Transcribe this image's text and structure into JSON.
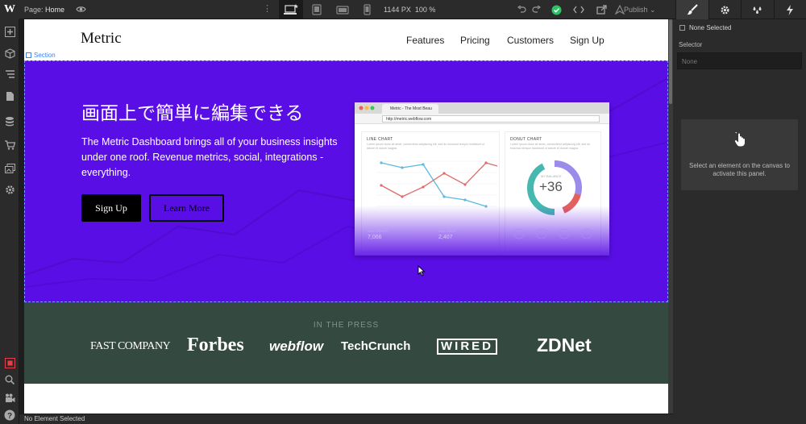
{
  "topbar": {
    "logo": "W",
    "page_prefix": "Page:",
    "page_name": "Home",
    "canvas_width": "1144 PX",
    "zoom": "100 %",
    "publish": "Publish"
  },
  "site": {
    "brand": "Metric",
    "nav": [
      "Features",
      "Pricing",
      "Customers",
      "Sign Up"
    ],
    "section_label": "Section",
    "hero": {
      "title": "画面上で簡単に編集できる",
      "subtitle": "The Metric Dashboard brings all of your business insights under one roof. Revenue metrics, social, integrations - everything.",
      "primary_button": "Sign Up",
      "secondary_button": "Learn More",
      "background": "#5a0ee6"
    },
    "mockup": {
      "tab_title": "Metric - The Most Beau",
      "url": "http://metric.webflow.com",
      "line_card_title": "LINE CHART",
      "donut_card_title": "DONUT CHART",
      "card_text": "Lorem ipsum dolor sit amet, consectetur adipiscing elit, sed do eiusmod tempor incididunt ut labore et dolore magna.",
      "donut_label": "MY BALANCE",
      "donut_value": "+36",
      "stat_1_label": "NEW SIGNUPS",
      "stat_1_value": "7,066",
      "stat_2_label": "NEW USERS",
      "stat_2_value": "2,407"
    },
    "press": {
      "label": "IN THE PRESS",
      "logos": [
        "FAST COMPANY",
        "Forbes",
        "webflow",
        "TechCrunch",
        "WIRED",
        "ZDNet"
      ],
      "background": "#34493f"
    }
  },
  "right_panel": {
    "none_selected": "None Selected",
    "selector_label": "Selector",
    "selector_value": "None",
    "hint": "Select an element on the canvas to activate this panel."
  },
  "statusbar": {
    "text": "No Element Selected"
  },
  "colors": {
    "accent_green": "#2bc464",
    "ui_dark": "#2b2b2b",
    "link_blue": "#3b82f6"
  }
}
